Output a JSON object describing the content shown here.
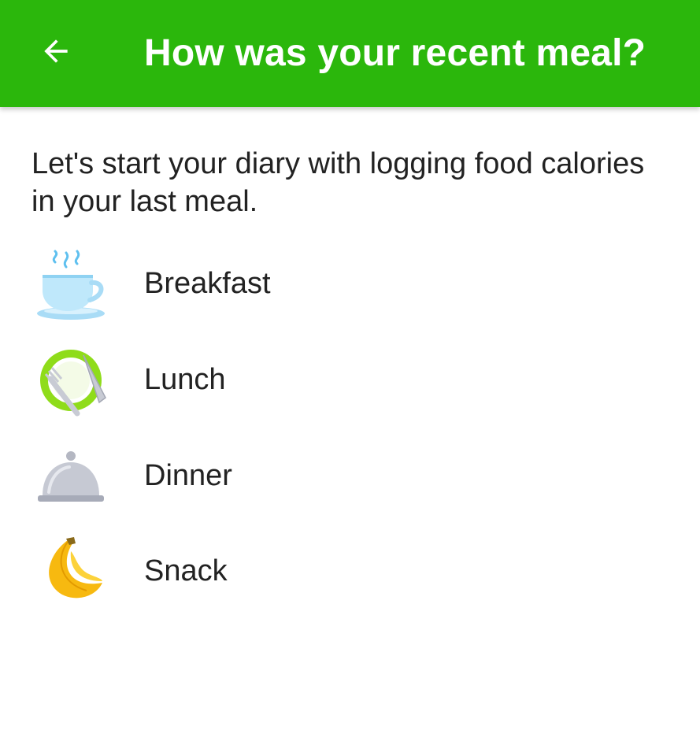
{
  "header": {
    "back_icon": "arrow-left-icon",
    "title": "How was your recent meal?",
    "background_color": "#2bb70c",
    "text_color": "#ffffff"
  },
  "intro": {
    "text": "Let's start your diary with logging food calories in your last meal."
  },
  "meals": [
    {
      "label": "Breakfast",
      "icon": "coffee-cup-icon"
    },
    {
      "label": "Lunch",
      "icon": "fork-knife-plate-icon"
    },
    {
      "label": "Dinner",
      "icon": "cloche-icon"
    },
    {
      "label": "Snack",
      "icon": "banana-icon"
    }
  ]
}
